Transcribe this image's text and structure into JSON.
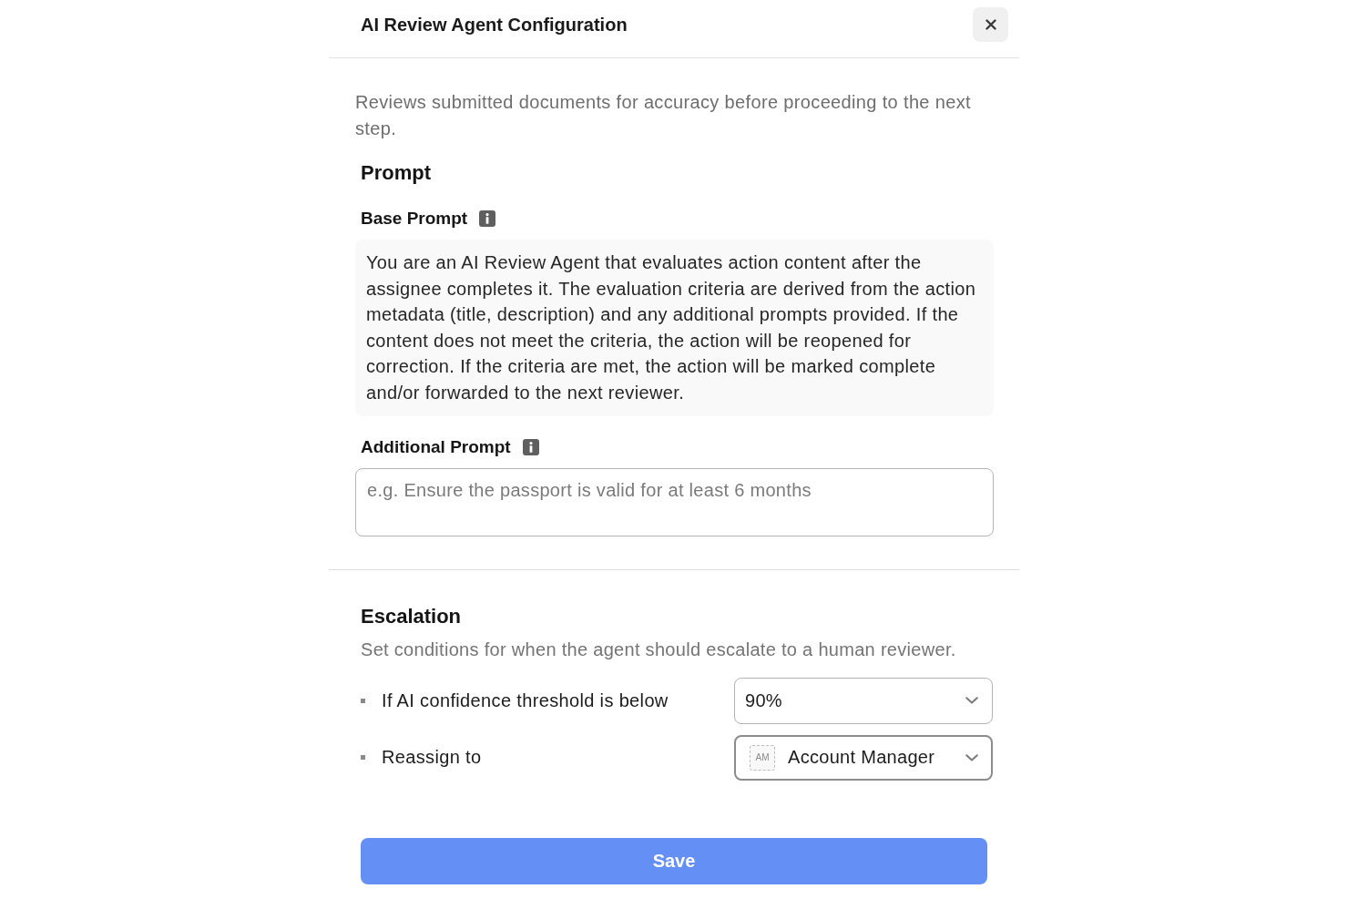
{
  "dialog": {
    "title": "AI Review Agent Configuration"
  },
  "description": "Reviews submitted documents for accuracy before proceeding to the next step.",
  "prompt": {
    "heading": "Prompt",
    "base_prompt": {
      "label": "Base Prompt",
      "text": "You are an AI Review Agent that evaluates action content after the assignee completes it. The evaluation criteria are derived from the action metadata (title, description) and any additional prompts provided. If the content does not meet the criteria, the action will be reopened for correction. If the criteria are met, the action will be marked complete and/or forwarded to the next reviewer."
    },
    "additional_prompt": {
      "label": "Additional Prompt",
      "placeholder": "e.g. Ensure the passport is valid for at least 6 months"
    }
  },
  "escalation": {
    "heading": "Escalation",
    "description": "Set conditions for when the agent should escalate to a human reviewer.",
    "rules": [
      {
        "label": "If AI confidence threshold is below",
        "value": "90%",
        "focused": false
      },
      {
        "label": "Reassign to",
        "avatar": "AM",
        "value": "Account Manager",
        "focused": true
      }
    ]
  },
  "save_button": "Save"
}
